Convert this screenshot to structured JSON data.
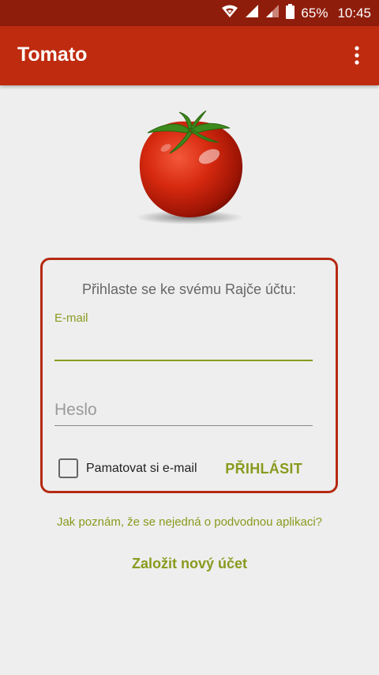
{
  "status_bar": {
    "battery": "65%",
    "time": "10:45",
    "icons": [
      "wifi-icon",
      "signal-icon",
      "signal-weak-icon",
      "battery-icon"
    ]
  },
  "app_bar": {
    "title": "Tomato",
    "menu_icon": "overflow-menu-icon"
  },
  "logo": {
    "icon": "tomato-icon"
  },
  "login_card": {
    "prompt": "Přihlaste se ke svému Rajče účtu:",
    "email_label": "E-mail",
    "email_value": "",
    "password_placeholder": "Heslo",
    "remember_label": "Pamatovat si e-mail",
    "remember_checked": false,
    "login_button": "PŘIHLÁSIT"
  },
  "links": {
    "fraud_question": "Jak poznám, že se nejedná o podvodnou aplikaci?",
    "create_account": "Založit nový účet"
  },
  "colors": {
    "status_bar": "#8f1d0c",
    "app_bar": "#bf2b0f",
    "accent": "#8a9a1e",
    "card_border": "#b52a12"
  }
}
